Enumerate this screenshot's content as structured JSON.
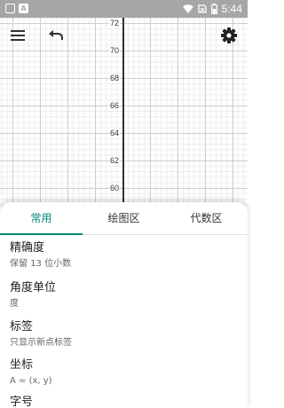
{
  "status_bar": {
    "time": "5:44",
    "notification_letter": "A"
  },
  "toolbar": {
    "menu_icon": "hamburger-menu-icon",
    "undo_icon": "undo-icon",
    "settings_icon": "gear-icon"
  },
  "graph": {
    "y_ticks": [
      "72",
      "70",
      "68",
      "66",
      "64",
      "62",
      "60"
    ],
    "grid_color": "#cfcfcf",
    "axis_color": "#333333"
  },
  "settings_panel": {
    "accent_color": "#00897b",
    "tabs": [
      {
        "label": "常用",
        "active": true
      },
      {
        "label": "绘图区",
        "active": false
      },
      {
        "label": "代数区",
        "active": false
      }
    ],
    "items": [
      {
        "title": "精确度",
        "value": "保留 13 位小数"
      },
      {
        "title": "角度单位",
        "value": "度"
      },
      {
        "title": "标签",
        "value": "只显示新点标签"
      },
      {
        "title": "坐标",
        "value": "A = (x, y)"
      },
      {
        "title": "字号",
        "value": ""
      }
    ]
  }
}
